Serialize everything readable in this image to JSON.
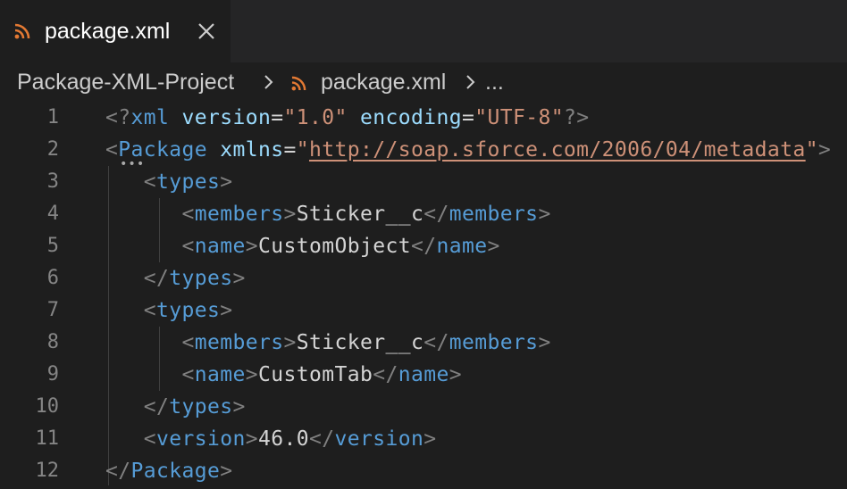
{
  "tab": {
    "title": "package.xml",
    "icon": "rss-icon",
    "close_icon": "close-icon"
  },
  "breadcrumb": {
    "project": "Package-XML-Project",
    "file": "package.xml",
    "more": "..."
  },
  "editor": {
    "line_numbers": [
      "1",
      "2",
      "3",
      "4",
      "5",
      "6",
      "7",
      "8",
      "9",
      "10",
      "11",
      "12"
    ],
    "code": {
      "l1": {
        "open": "<?",
        "tag": "xml",
        "attr1": "version",
        "eq1": "=",
        "val1": "\"1.0\"",
        "attr2": "encoding",
        "eq2": "=",
        "val2": "\"UTF-8\"",
        "close": "?>"
      },
      "l2": {
        "open": "<",
        "tag": "Package",
        "attr": "xmlns",
        "eq": "=",
        "q1": "\"",
        "url": "http://soap.sforce.com/2006/04/metadata",
        "q2": "\"",
        "close": ">"
      },
      "l3": {
        "open": "<",
        "tag": "types",
        "close": ">"
      },
      "l4": {
        "open": "<",
        "tag": "members",
        "close": ">",
        "text": "Sticker__c",
        "endopen": "</",
        "endtag": "members",
        "endclose": ">"
      },
      "l5": {
        "open": "<",
        "tag": "name",
        "close": ">",
        "text": "CustomObject",
        "endopen": "</",
        "endtag": "name",
        "endclose": ">"
      },
      "l6": {
        "open": "</",
        "tag": "types",
        "close": ">"
      },
      "l7": {
        "open": "<",
        "tag": "types",
        "close": ">"
      },
      "l8": {
        "open": "<",
        "tag": "members",
        "close": ">",
        "text": "Sticker__c",
        "endopen": "</",
        "endtag": "members",
        "endclose": ">"
      },
      "l9": {
        "open": "<",
        "tag": "name",
        "close": ">",
        "text": "CustomTab",
        "endopen": "</",
        "endtag": "name",
        "endclose": ">"
      },
      "l10": {
        "open": "</",
        "tag": "types",
        "close": ">"
      },
      "l11": {
        "open": "<",
        "tag": "version",
        "close": ">",
        "text": "46.0",
        "endopen": "</",
        "endtag": "version",
        "endclose": ">"
      },
      "l12": {
        "open": "</",
        "tag": "Package",
        "close": ">"
      }
    }
  },
  "colors": {
    "background": "#1e1e1e",
    "tab_bar": "#252526",
    "tag_name": "#569cd6",
    "attribute": "#9cdcfe",
    "string": "#ce9178",
    "punctuation": "#808080",
    "rss_icon": "#e37933"
  }
}
